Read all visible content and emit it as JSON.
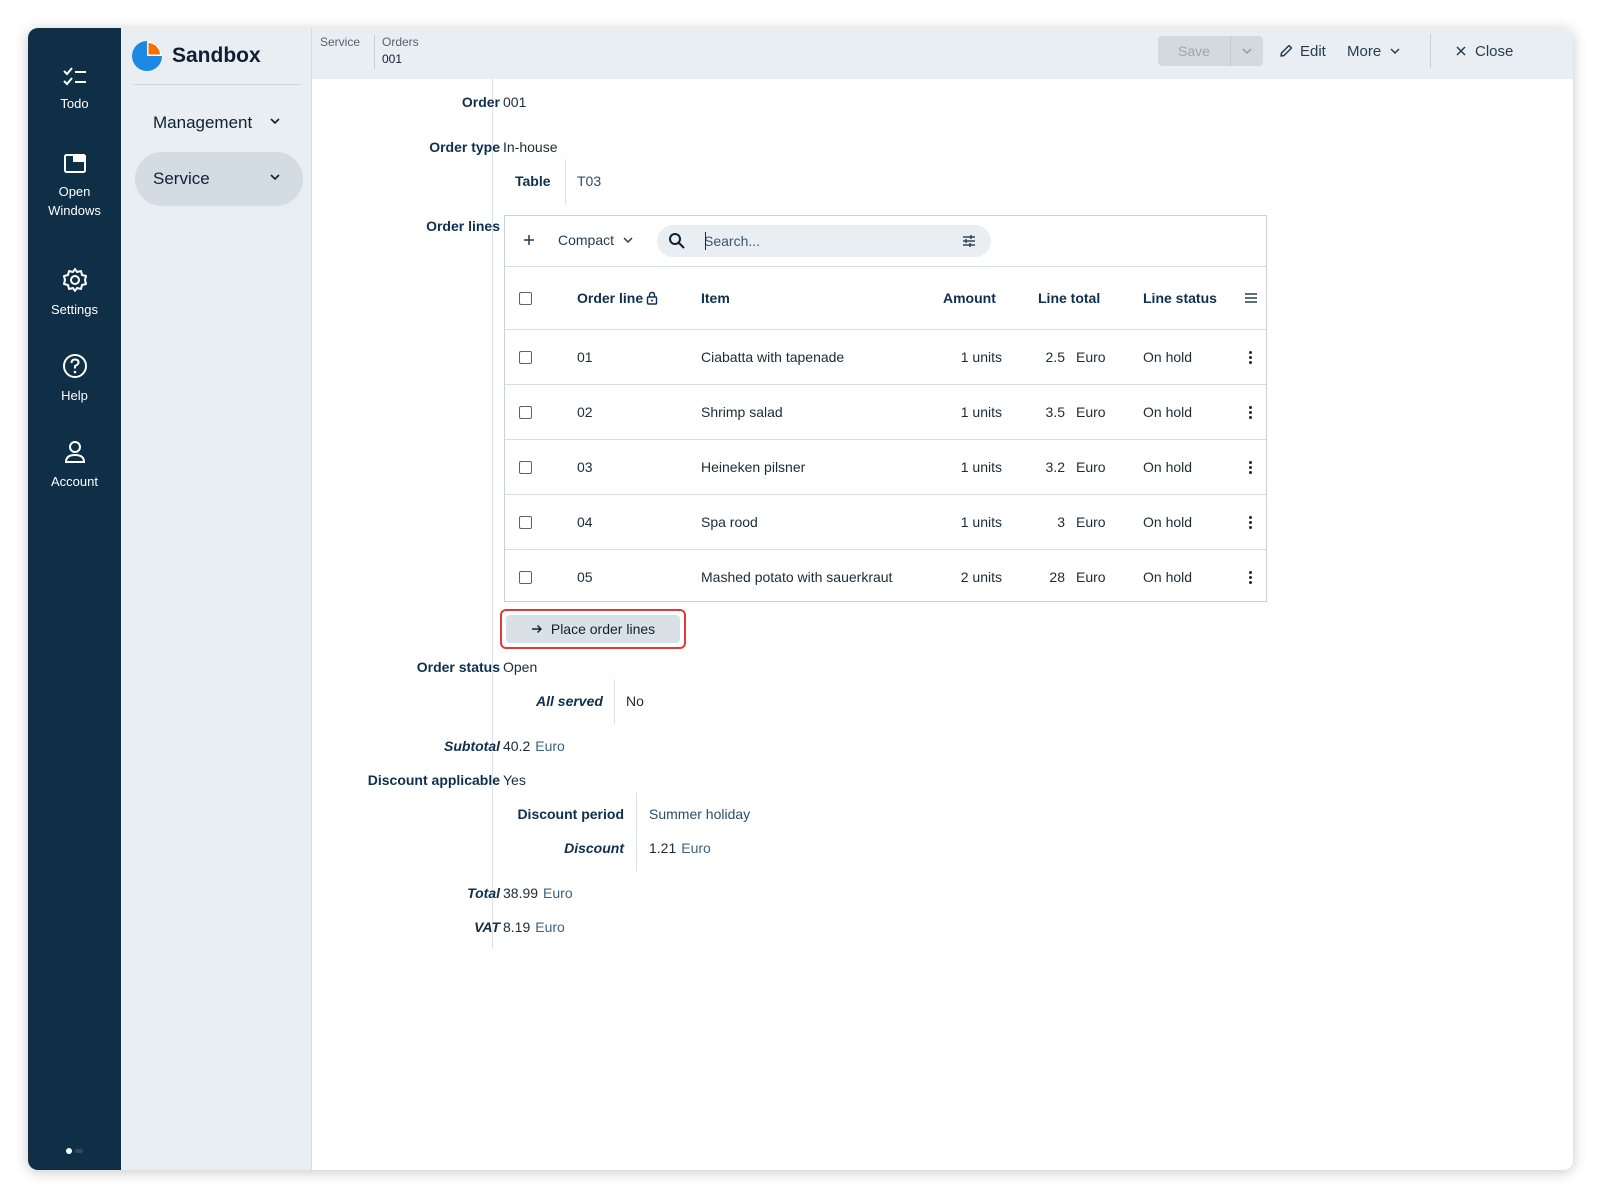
{
  "rail": {
    "items": [
      {
        "label": "Todo",
        "icon": "checklist-icon"
      },
      {
        "label": "Open\nWindows",
        "label1": "Open",
        "label2": "Windows",
        "icon": "window-icon"
      },
      {
        "label": "Settings",
        "icon": "gear-icon"
      },
      {
        "label": "Help",
        "icon": "help-icon"
      },
      {
        "label": "Account",
        "icon": "user-icon"
      }
    ]
  },
  "brand": {
    "name": "Sandbox",
    "logo_colors": [
      "#1e88e5",
      "#ff6d00"
    ]
  },
  "nav": {
    "items": [
      {
        "label": "Management",
        "active": false
      },
      {
        "label": "Service",
        "active": true
      }
    ]
  },
  "breadcrumb": {
    "root": "Service",
    "section": "Orders",
    "record": "001"
  },
  "toolbar": {
    "save_label": "Save",
    "edit_label": "Edit",
    "more_label": "More",
    "close_label": "Close"
  },
  "form": {
    "order_label": "Order",
    "order_value": "001",
    "order_type_label": "Order type",
    "order_type_value": "In-house",
    "table_label": "Table",
    "table_value": "T03",
    "order_lines_label": "Order lines",
    "order_status_label": "Order status",
    "order_status_value": "Open",
    "all_served_label": "All served",
    "all_served_value": "No",
    "subtotal_label": "Subtotal",
    "subtotal_value": "40.2",
    "subtotal_unit": "Euro",
    "discount_applicable_label": "Discount applicable",
    "discount_applicable_value": "Yes",
    "discount_period_label": "Discount period",
    "discount_period_value": "Summer holiday",
    "discount_label": "Discount",
    "discount_value": "1.21",
    "discount_unit": "Euro",
    "total_label": "Total",
    "total_value": "38.99",
    "total_unit": "Euro",
    "vat_label": "VAT",
    "vat_value": "8.19",
    "vat_unit": "Euro"
  },
  "order_lines": {
    "view_mode": "Compact",
    "search_placeholder": "Search...",
    "columns": [
      "Order line",
      "Item",
      "Amount",
      "Line total",
      "Line status"
    ],
    "rows": [
      {
        "line": "01",
        "item": "Ciabatta with tapenade",
        "amount": "1 units",
        "total": "2.5",
        "currency": "Euro",
        "status": "On hold"
      },
      {
        "line": "02",
        "item": "Shrimp salad",
        "amount": "1 units",
        "total": "3.5",
        "currency": "Euro",
        "status": "On hold"
      },
      {
        "line": "03",
        "item": "Heineken pilsner",
        "amount": "1 units",
        "total": "3.2",
        "currency": "Euro",
        "status": "On hold"
      },
      {
        "line": "04",
        "item": "Spa rood",
        "amount": "1 units",
        "total": "3",
        "currency": "Euro",
        "status": "On hold"
      },
      {
        "line": "05",
        "item": "Mashed potato with sauerkraut",
        "amount": "2 units",
        "total": "28",
        "currency": "Euro",
        "status": "On hold"
      }
    ],
    "place_button_label": "Place order lines"
  },
  "colors": {
    "rail_bg": "#0e2f45",
    "panel_bg": "#e9eef2",
    "label_color": "#0e2f4e",
    "highlight": "#e03a3a"
  }
}
